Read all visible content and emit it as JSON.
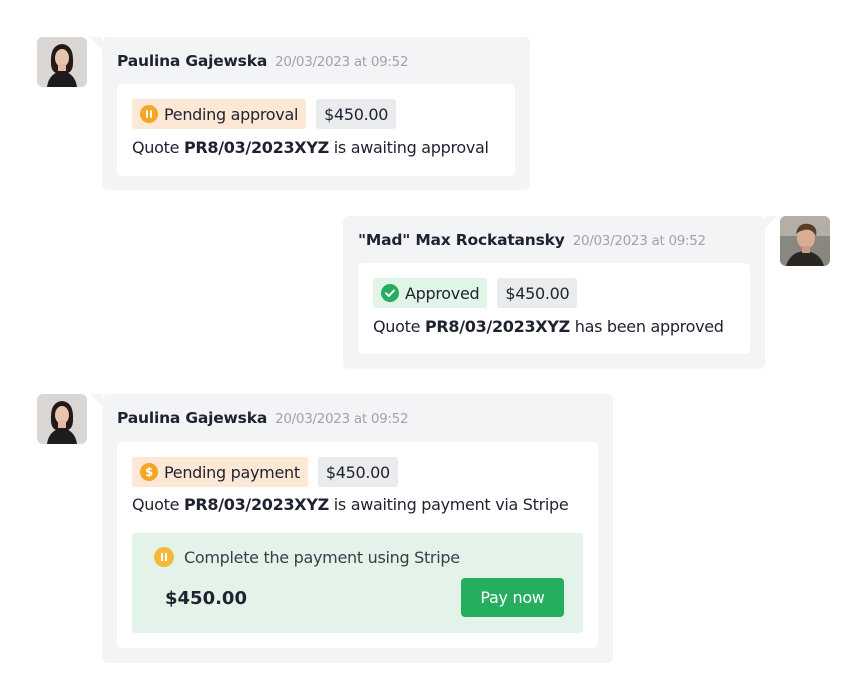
{
  "messages": [
    {
      "author": "Paulina Gajewska",
      "timestamp": "20/03/2023 at 09:52",
      "status": "Pending approval",
      "status_icon": "pause-icon",
      "amount": "$450.00",
      "text_prefix": "Quote ",
      "quote_id": "PR8/03/2023XYZ",
      "text_suffix": " is awaiting approval"
    },
    {
      "author": "\"Mad\" Max Rockatansky",
      "timestamp": "20/03/2023 at 09:52",
      "status": "Approved",
      "status_icon": "check-icon",
      "amount": "$450.00",
      "text_prefix": "Quote ",
      "quote_id": "PR8/03/2023XYZ",
      "text_suffix": " has been approved"
    },
    {
      "author": "Paulina Gajewska",
      "timestamp": "20/03/2023 at 09:52",
      "status": "Pending payment",
      "status_icon": "dollar-icon",
      "amount": "$450.00",
      "text_prefix": "Quote ",
      "quote_id": "PR8/03/2023XYZ",
      "text_suffix": " is awaiting payment via Stripe",
      "payment": {
        "title": "Complete the payment using Stripe",
        "amount": "$450.00",
        "button_label": "Pay now"
      }
    }
  ],
  "colors": {
    "pending": "#f5a623",
    "approved": "#25ae5f",
    "pay_button": "#25ae5f",
    "bubble_bg": "#f3f4f6"
  }
}
